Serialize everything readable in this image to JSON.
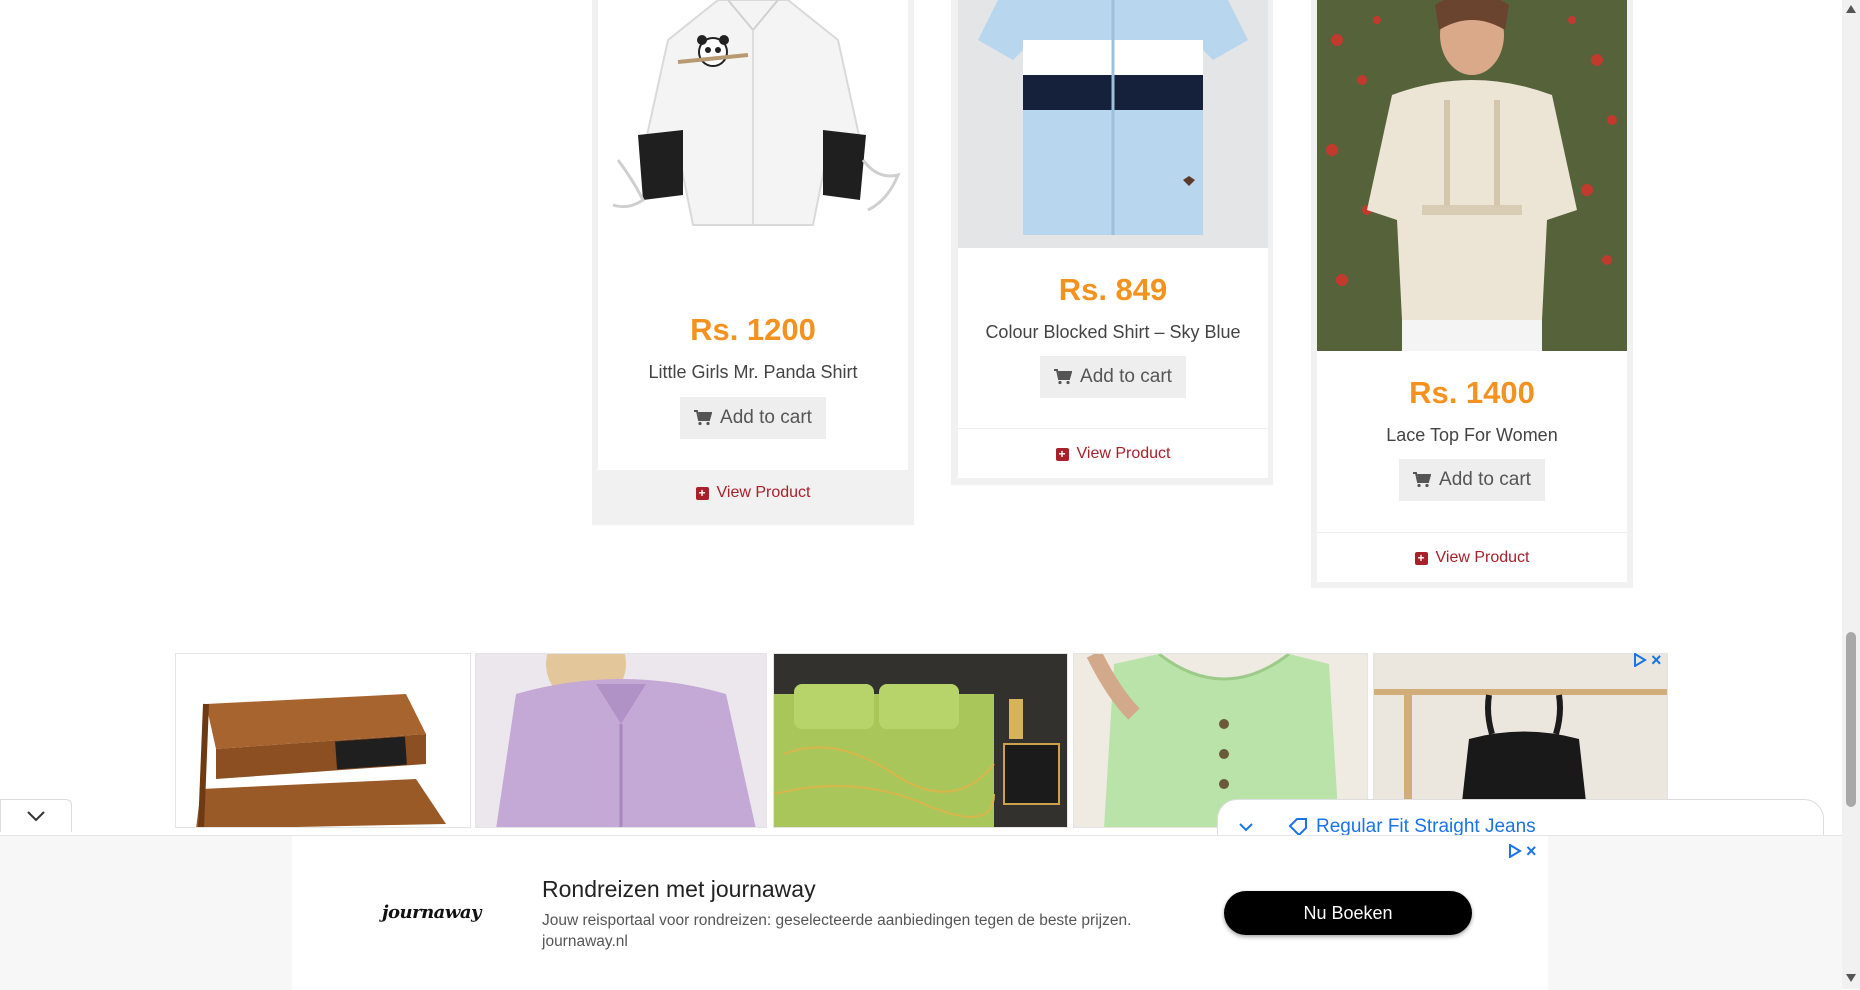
{
  "products": [
    {
      "price": "Rs. 1200",
      "name": "Little Girls Mr. Panda Shirt",
      "add_to_cart": "Add to cart",
      "view": "View Product"
    },
    {
      "price": "Rs. 849",
      "name": "Colour Blocked Shirt – Sky Blue",
      "add_to_cart": "Add to cart",
      "view": "View Product"
    },
    {
      "price": "Rs. 1400",
      "name": "Lace Top For Women",
      "add_to_cart": "Add to cart",
      "view": "View Product"
    }
  ],
  "ad_strip": {
    "overlay_text": "Regular Fit Straight Jeans",
    "tiles": [
      "wooden-organizer",
      "lilac-satin-blouse",
      "green-bedding-set",
      "green-knit-tank",
      "black-handbag"
    ]
  },
  "banner": {
    "logo": "journaway",
    "title": "Rondreizen met journaway",
    "description": "Jouw reisportaal voor rondreizen: geselecteerde aanbiedingen tegen de beste prijzen. journaway.nl",
    "cta": "Nu Boeken"
  },
  "icons": {
    "cart": "cart-icon",
    "view": "plus-square-icon",
    "adchoices": "adchoices-icon",
    "close": "close-icon",
    "collapse": "chevron-down-icon"
  },
  "colors": {
    "price": "#f3921e",
    "view_link": "#a8202a",
    "ad_link": "#1a73e8",
    "cta_bg": "#000000"
  }
}
